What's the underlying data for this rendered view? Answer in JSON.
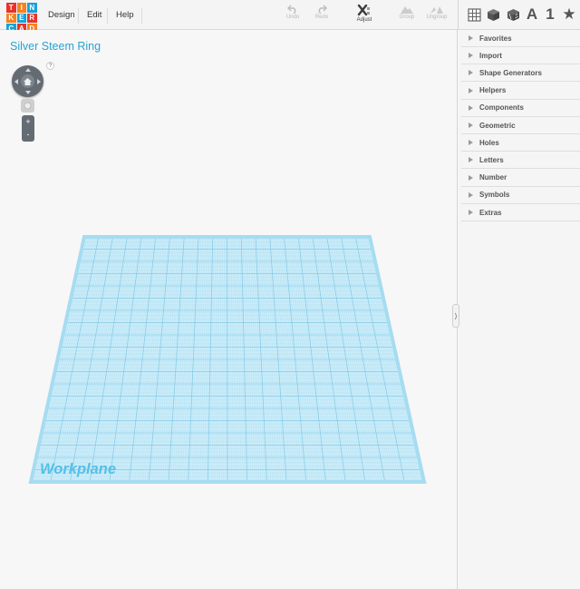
{
  "logo": {
    "letters": [
      "T",
      "I",
      "N",
      "K",
      "E",
      "R",
      "C",
      "A",
      "D"
    ],
    "colors": [
      "#e8332a",
      "#f58220",
      "#1aa1d8",
      "#f58220",
      "#1aa1d8",
      "#e8332a",
      "#1aa1d8",
      "#e8332a",
      "#f58220"
    ]
  },
  "menu": {
    "design": "Design",
    "edit": "Edit",
    "help": "Help"
  },
  "toolbar": {
    "undo": "Undo",
    "redo": "Redo",
    "adjust": "Adjust",
    "group": "Group",
    "ungroup": "Ungroup"
  },
  "view_buttons": {
    "grid_icon": "grid-view-icon",
    "box_icon": "solid-box-icon",
    "texture_icon": "textured-box-icon",
    "letter": "A",
    "number": "1",
    "star": "★"
  },
  "workspace": {
    "project_title": "Silver Steem Ring",
    "help_mark": "?",
    "zoom_in": "+",
    "zoom_out": "-",
    "workplane_label": "Workplane",
    "colors": {
      "grid": "#7cc8e6",
      "plane": "#cfeefa",
      "border": "#a9dcef",
      "label": "#5cc3ea"
    }
  },
  "collapse_arrow": "⟩",
  "categories": [
    "Favorites",
    "Import",
    "Shape Generators",
    "Helpers",
    "Components",
    "Geometric",
    "Holes",
    "Letters",
    "Number",
    "Symbols",
    "Extras"
  ]
}
